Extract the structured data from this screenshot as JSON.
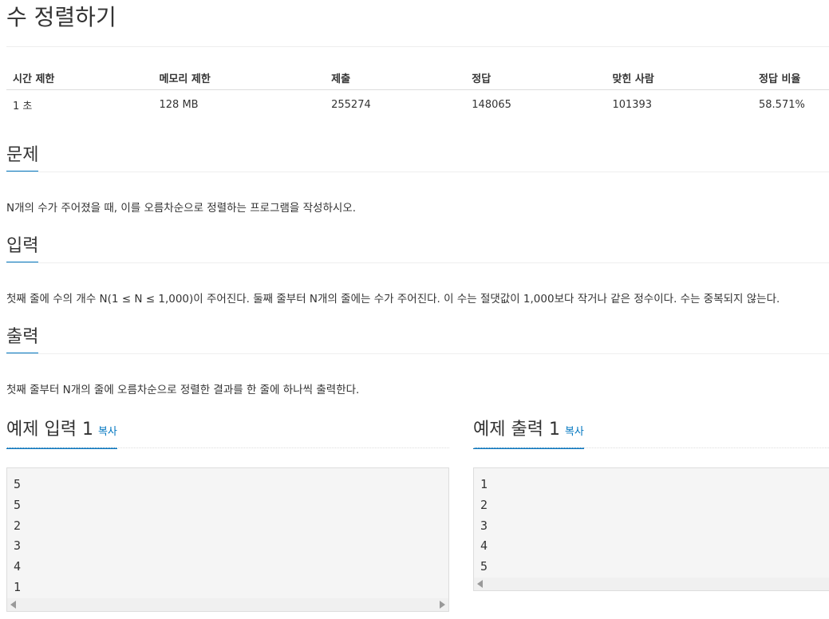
{
  "page_title": "수 정렬하기",
  "info_table": {
    "headers": [
      "시간 제한",
      "메모리 제한",
      "제출",
      "정답",
      "맞힌 사람",
      "정답 비율"
    ],
    "values": [
      "1 초",
      "128 MB",
      "255274",
      "148065",
      "101393",
      "58.571%"
    ]
  },
  "sections": {
    "problem": {
      "title": "문제",
      "text": "N개의 수가 주어졌을 때, 이를 오름차순으로 정렬하는 프로그램을 작성하시오."
    },
    "input": {
      "title": "입력",
      "text": "첫째 줄에 수의 개수 N(1 ≤ N ≤ 1,000)이 주어진다. 둘째 줄부터 N개의 줄에는 수가 주어진다. 이 수는 절댓값이 1,000보다 작거나 같은 정수이다. 수는 중복되지 않는다."
    },
    "output": {
      "title": "출력",
      "text": "첫째 줄부터 N개의 줄에 오름차순으로 정렬한 결과를 한 줄에 하나씩 출력한다."
    }
  },
  "samples": {
    "input": {
      "title": "예제 입력 1",
      "copy_label": "복사",
      "content": "5\n5\n2\n3\n4\n1"
    },
    "output": {
      "title": "예제 출력 1",
      "copy_label": "복사",
      "content": "1\n2\n3\n4\n5"
    }
  }
}
